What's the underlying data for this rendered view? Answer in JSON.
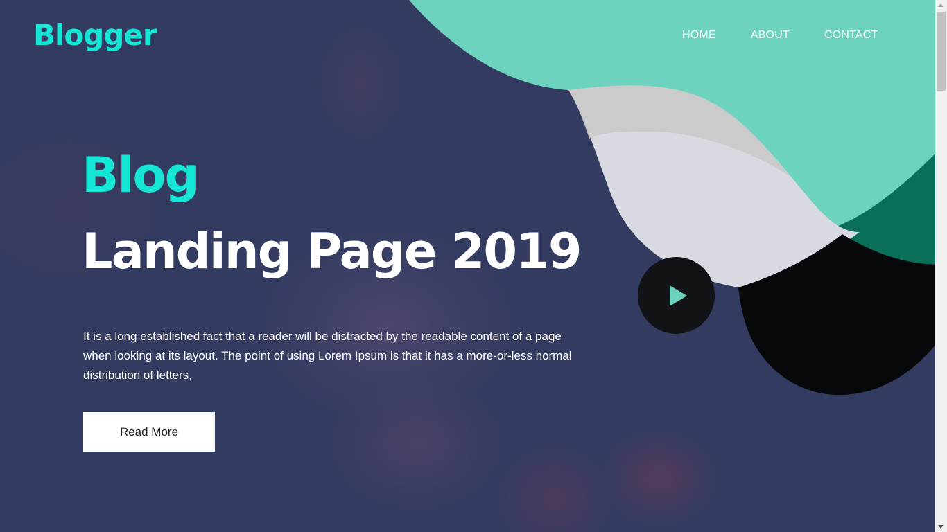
{
  "header": {
    "logo": "Blogger",
    "nav": [
      {
        "label": "HOME"
      },
      {
        "label": "ABOUT"
      },
      {
        "label": "CONTACT"
      }
    ]
  },
  "hero": {
    "title_line1": "Blog",
    "title_line2": "Landing Page 2019",
    "description": "It is a long established fact that a reader will be distracted by the readable content of a page when looking at its layout. The point of using Lorem Ipsum is that it has a more-or-less normal distribution of letters,",
    "cta_label": "Read More",
    "play_icon": "play-icon"
  },
  "colors": {
    "accent": "#15e6d6",
    "background": "#343b60",
    "teal_shape": "#6dd3bf",
    "dark_green_shape": "#0a6f58",
    "light_grey_shape": "#d9d9e1",
    "black_shape": "#07080a",
    "button_bg": "#ffffff"
  }
}
